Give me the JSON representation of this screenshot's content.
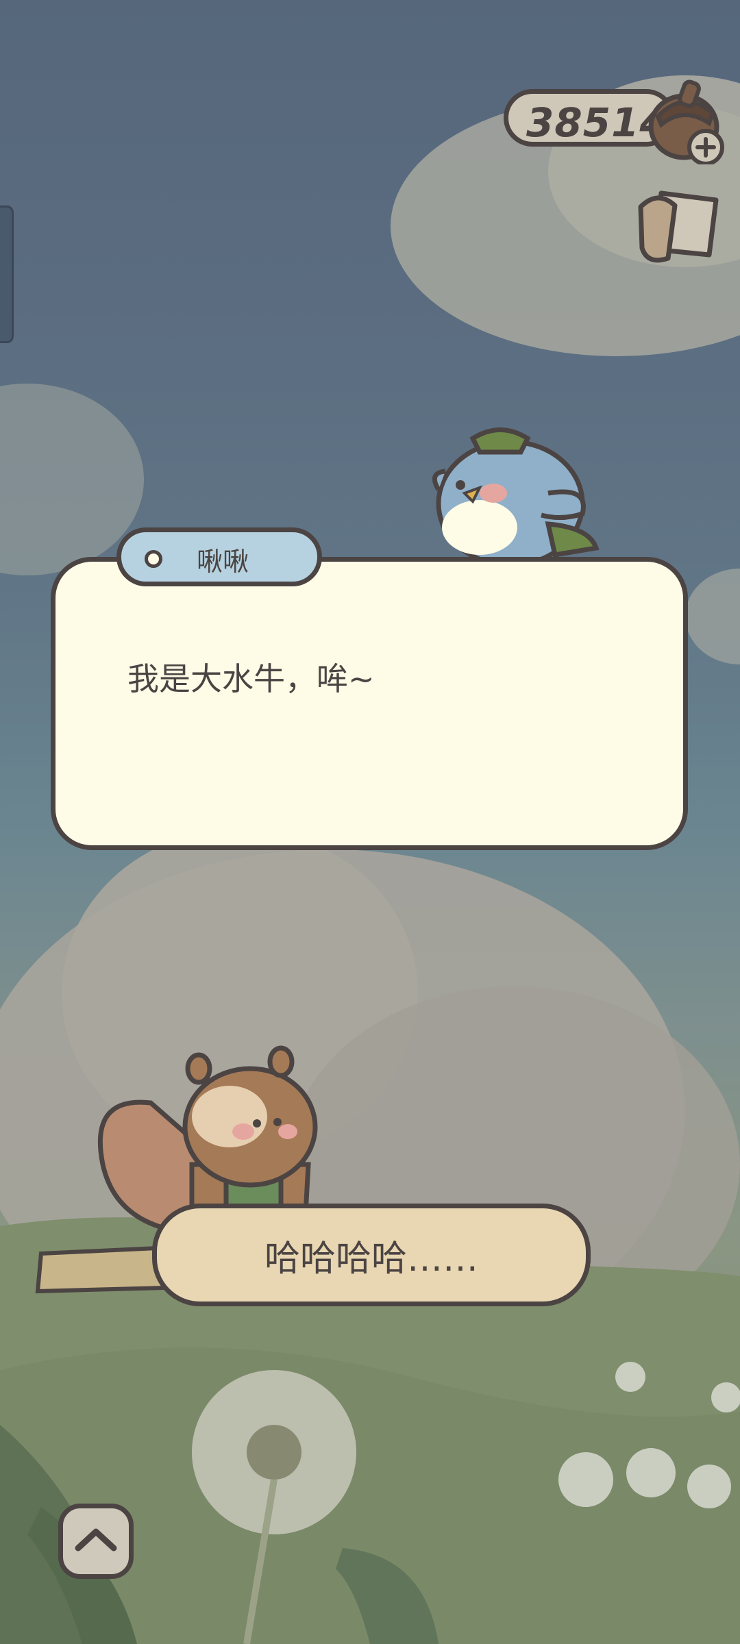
{
  "hud": {
    "currency_value": "385140",
    "currency_icon": "acorn-icon",
    "currency_add_icon": "plus-icon",
    "scroll_icon": "scroll-icon"
  },
  "dialog": {
    "speaker": "啾啾",
    "text": "我是大水牛，哞~"
  },
  "choice": {
    "label": "哈哈哈哈……"
  },
  "controls": {
    "up_icon": "chevron-up-icon"
  },
  "colors": {
    "outline": "#4b4443",
    "dialog_bg": "#fefbe7",
    "name_tag_bg": "#b6d2e0",
    "choice_bg": "#e8d7b2"
  }
}
